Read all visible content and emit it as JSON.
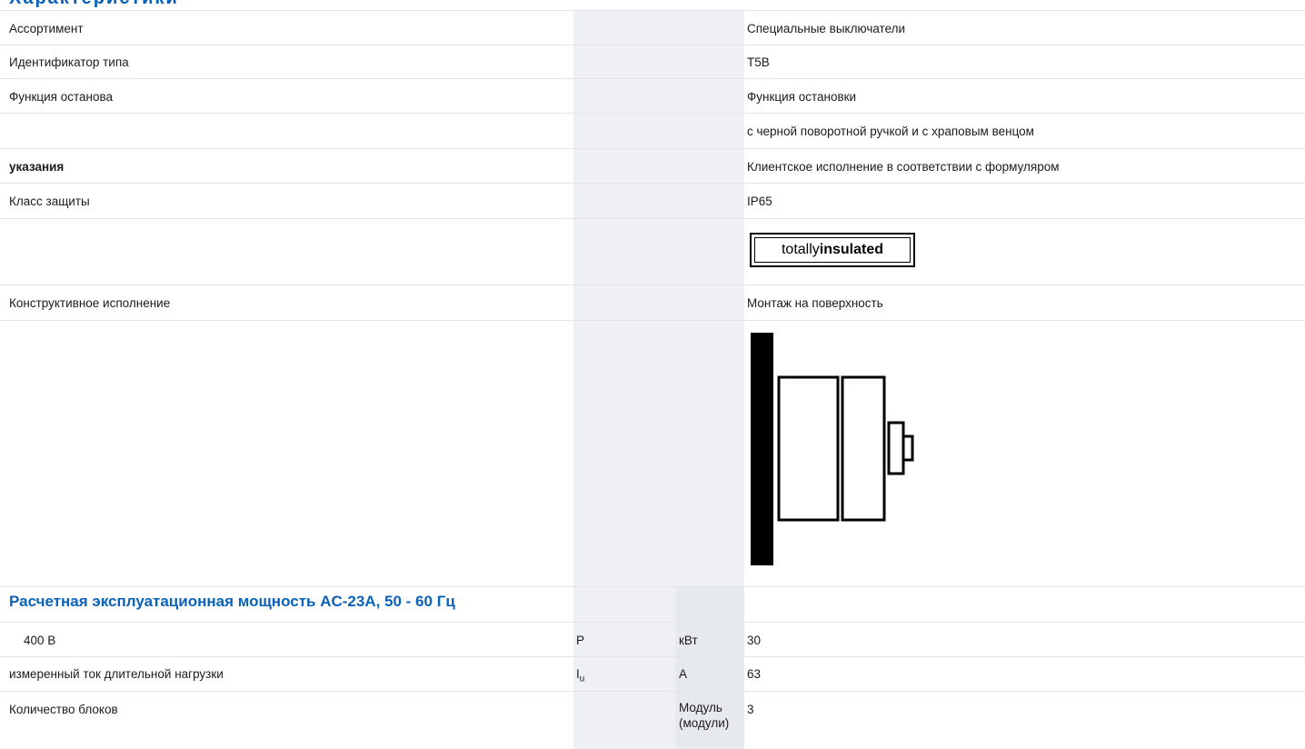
{
  "header": {
    "heading": "Характеристики"
  },
  "rows": [
    {
      "label": "Ассортимент",
      "value": "Специальные выключатели"
    },
    {
      "label": "Идентификатор типа",
      "value": "T5B"
    },
    {
      "label": "Функция останова",
      "value": "Функция остановки"
    },
    {
      "label": "",
      "value": "с черной поворотной ручкой и с храповым венцом"
    },
    {
      "label": "указания",
      "value": "Клиентское исполнение в соответствии с формуляром"
    },
    {
      "label": "Класс защиты",
      "value": "IP65"
    },
    {
      "label": "Конструктивное исполнение",
      "value": "Монтаж на поверхность"
    }
  ],
  "badge": {
    "text_light": "tot",
    "text_mid": "ally",
    "text_bold": " insulated"
  },
  "section": {
    "title": "Расчетная эксплуатационная мощность AC-23A, 50 - 60 Гц"
  },
  "data_rows": [
    {
      "label": "400 В",
      "symbol": "P",
      "unit": "кВт",
      "value": "30"
    },
    {
      "label": "измеренный ток длительной нагрузки",
      "symbol": "I",
      "symbol_sub": "u",
      "unit": "А",
      "value": "63"
    },
    {
      "label": "Количество блоков",
      "symbol": "",
      "unit": "Модуль (модули)",
      "value": "3"
    }
  ],
  "colors": {
    "accent": "#0a62b8",
    "shade": "#eef0f3"
  }
}
